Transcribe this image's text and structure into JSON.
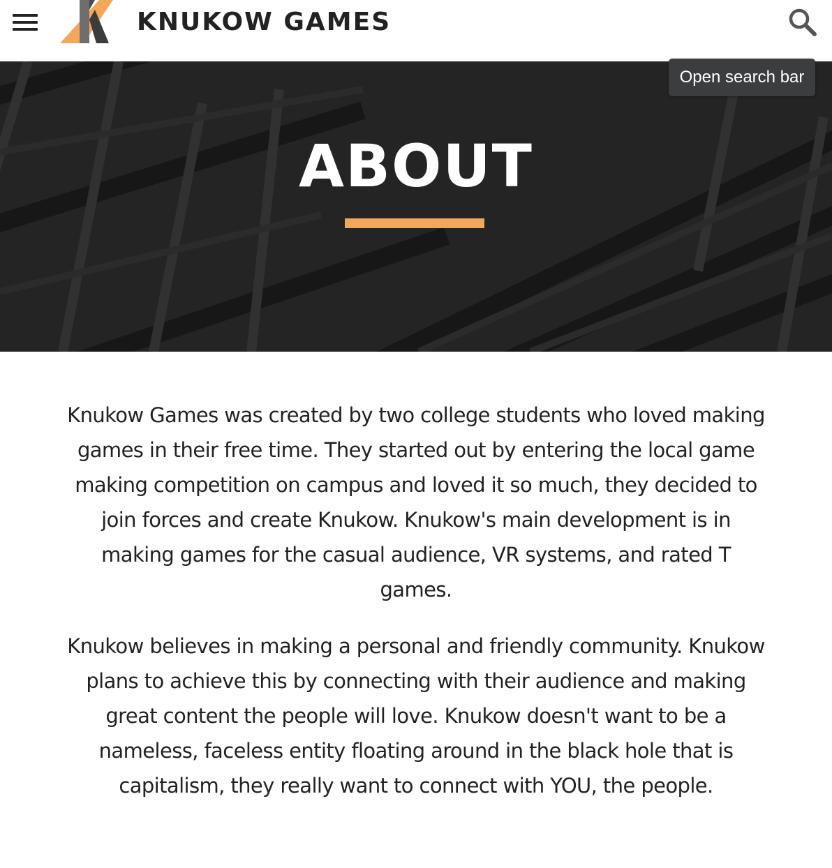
{
  "header": {
    "brand": "KNUKOW GAMES",
    "menu_icon": "hamburger-menu-icon",
    "logo_icon": "knukow-k-logo",
    "search_icon": "magnifier-search-icon",
    "tooltip": "Open search bar"
  },
  "hero": {
    "title": "ABOUT",
    "accent_color": "#f2a85a"
  },
  "content": {
    "paragraphs": [
      "Knukow Games was created by two college students who loved making games in their free time. They started out by entering the local game making competition on campus and loved it so much, they decided to join forces and create Knukow. Knukow's main development is in making games for the casual audience, VR systems, and rated T games.",
      "Knukow believes in making a personal and friendly community. Knukow plans to achieve this by connecting with their audience and making great content the people will love. Knukow doesn't want to be a nameless, faceless entity floating around in the black hole that is capitalism, they really want to connect with YOU, the people."
    ]
  },
  "colors": {
    "accent": "#f2a85a",
    "hero_bg": "#2a2a2a",
    "text": "#222222"
  }
}
